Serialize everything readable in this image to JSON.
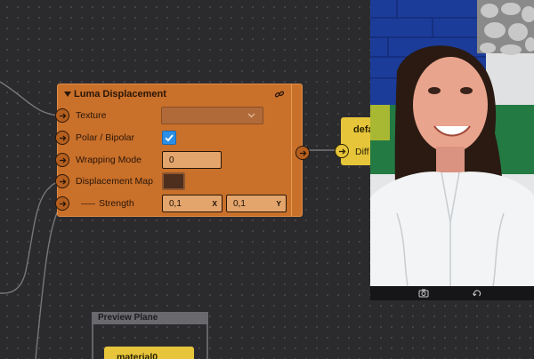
{
  "luma_node": {
    "title": "Luma Displacement",
    "rows": [
      {
        "label": "Texture",
        "control": "dropdown",
        "value": ""
      },
      {
        "label": "Polar / Bipolar",
        "control": "checkbox",
        "checked": true
      },
      {
        "label": "Wrapping Mode",
        "control": "number",
        "value": "0"
      },
      {
        "label": "Displacement Map",
        "control": "color"
      },
      {
        "label": "Strength",
        "control": "vector2",
        "x": "0,1",
        "y": "0,1",
        "x_tag": "X",
        "y_tag": "Y"
      }
    ]
  },
  "default_node": {
    "title": "defa",
    "input_label": "Diff"
  },
  "preview_plane": {
    "title": "Preview Plane",
    "child_node_title": "material0"
  },
  "colors": {
    "canvas_bg": "#2b2b2e",
    "luma_node": "#c9702a",
    "yellow_node": "#e6c53a",
    "checkbox_blue": "#2d8ee6",
    "frame_gray": "#6a6a6e"
  },
  "icons": {
    "header_link": "link-icon",
    "socket": "arrow-right-icon",
    "dropdown": "chevron-down-icon",
    "check": "checkmark-icon",
    "preview_left": "camera-capture-icon",
    "preview_right": "rotate-icon"
  }
}
